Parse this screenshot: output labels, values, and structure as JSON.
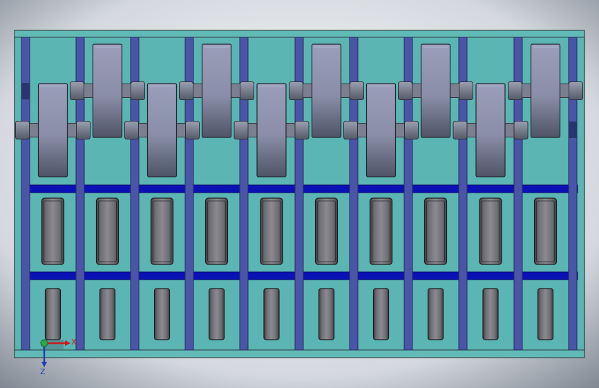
{
  "triad": {
    "x_label": "X",
    "z_label": "Z"
  },
  "colors": {
    "frame": "#5bb5b2",
    "divider": "#4a55a6",
    "rail": "#0a12b6",
    "wheel": "#8c90b0",
    "roller": "#6b6b70"
  },
  "layout_counts": {
    "columns": 10
  }
}
